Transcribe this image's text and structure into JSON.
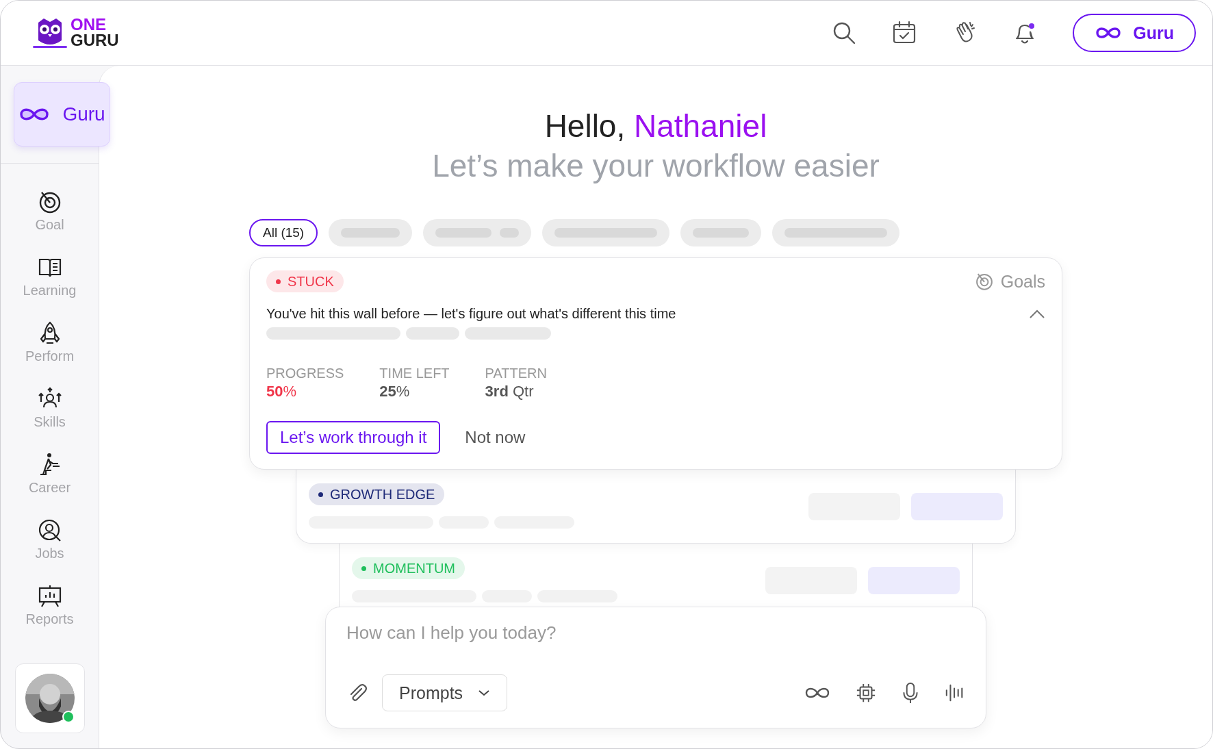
{
  "logo": {
    "line1": "ONE",
    "line2": "GURU"
  },
  "header": {
    "guru_button": "Guru"
  },
  "sidebar": {
    "guru_button": "Guru",
    "items": [
      {
        "label": "Goal",
        "kind": "goal"
      },
      {
        "label": "Learning",
        "kind": "learning"
      },
      {
        "label": "Perform",
        "kind": "perform"
      },
      {
        "label": "Skills",
        "kind": "skills"
      },
      {
        "label": "Career",
        "kind": "career"
      },
      {
        "label": "Jobs",
        "kind": "jobs"
      },
      {
        "label": "Reports",
        "kind": "reports"
      }
    ],
    "user": {
      "online": true
    }
  },
  "greeting": {
    "hello": "Hello,",
    "name": "Nathaniel",
    "subtitle": "Let’s make your workflow easier"
  },
  "filters": [
    {
      "label": "All (15)",
      "selected": true
    }
  ],
  "cards": [
    {
      "tag": "STUCK",
      "color": "#f0364a",
      "category": "Goals",
      "message": "You've hit this wall before — let's figure out what's different this time",
      "stats": [
        {
          "label": "PROGRESS",
          "value": "**50**%",
          "color": "#f0364a"
        },
        {
          "label": "TIME LEFT",
          "value": "**25**%",
          "color": "#555555"
        },
        {
          "label": "PATTERN",
          "value": "**3rd** Qtr",
          "color": "#555555"
        }
      ],
      "primary_action": "Let’s work through it",
      "secondary_action": "Not now"
    },
    {
      "tag": "GROWTH EDGE",
      "color": "#1e2a78"
    },
    {
      "tag": "MOMENTUM",
      "color": "#1fbf5c"
    }
  ],
  "composer": {
    "placeholder": "How can I help you today?",
    "prompts_button": "Prompts"
  }
}
